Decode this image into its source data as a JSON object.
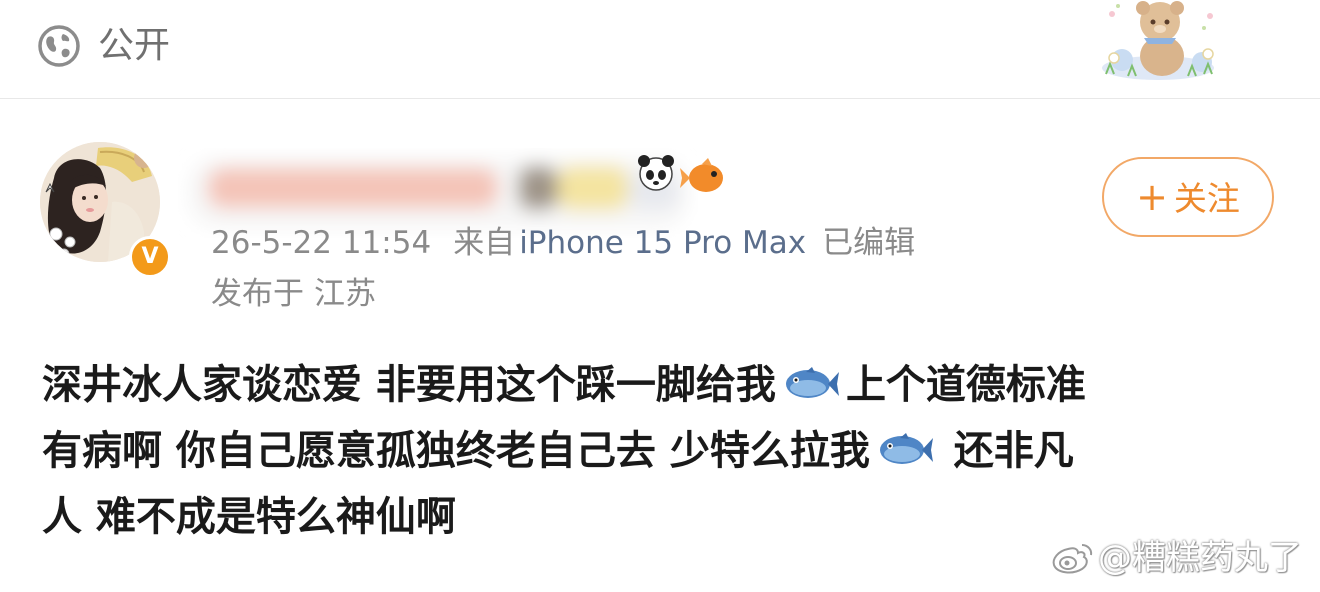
{
  "header": {
    "visibility_label": "公开",
    "globe_icon": "globe-icon",
    "sticker": "bear-sticker"
  },
  "post": {
    "user": {
      "avatar": "avatar-image",
      "verified_badge": "V",
      "name_blurred": true
    },
    "time": "26-5-22 11:54",
    "source_prefix": "来自",
    "device": "iPhone 15 Pro Max",
    "edited": "已编辑",
    "location_prefix": "发布于",
    "location": "江苏",
    "follow_plus": "+",
    "follow_label": "关注",
    "content": {
      "line1_a": "深井冰人家谈恋爱 非要用这个踩一脚给我",
      "line1_b": "上个道德标准",
      "line2_a": "有病啊 你自己愿意孤独终老自己去 少特么拉我",
      "line2_b": " 还非凡",
      "line3": "人 难不成是特么神仙啊"
    }
  },
  "watermark": {
    "text": "@糟糕药丸了",
    "icon": "weibo-logo-icon"
  },
  "colors": {
    "follow": "#ee8a2e",
    "meta": "#8a8a8a",
    "text": "#1a1a1a",
    "badge": "#f39a1a"
  }
}
